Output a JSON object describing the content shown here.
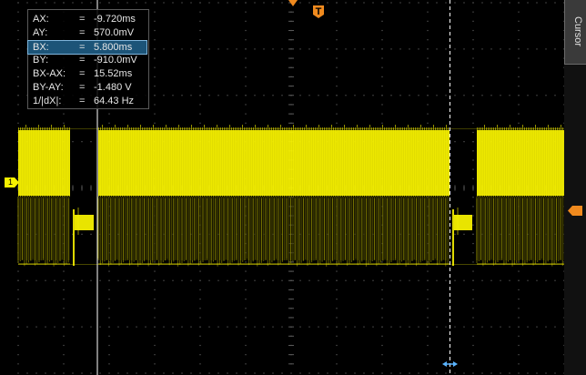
{
  "cursor_panel": {
    "rows": [
      {
        "label": "AX:",
        "eq": "=",
        "value": "-9.720ms",
        "highlighted": false
      },
      {
        "label": "AY:",
        "eq": "=",
        "value": "570.0mV",
        "highlighted": false
      },
      {
        "label": "BX:",
        "eq": "=",
        "value": "5.800ms",
        "highlighted": true
      },
      {
        "label": "BY:",
        "eq": "=",
        "value": "-910.0mV",
        "highlighted": false
      },
      {
        "label": "BX-AX:",
        "eq": "=",
        "value": "15.52ms",
        "highlighted": false
      },
      {
        "label": "BY-AY:",
        "eq": "=",
        "value": "-1.480 V",
        "highlighted": false
      },
      {
        "label": "1/|dX|:",
        "eq": "=",
        "value": "64.43 Hz",
        "highlighted": false
      }
    ]
  },
  "side_menu": {
    "title": "Cursor"
  },
  "markers": {
    "trigger_label": "T",
    "channel_label": "1"
  },
  "colors": {
    "background": "#000000",
    "grid": "#5a5a5a",
    "trace": "#f5f000",
    "trace_dim": "#8a8400",
    "marker_orange": "#f08a1e",
    "cursor_line": "#ffffff",
    "channel_marker": "#f5f000",
    "highlight": "#1c5478"
  },
  "icons": {
    "trigger_position": "trigger-arrow-icon",
    "channel_offset": "channel-1-marker-icon",
    "trigger_level": "trigger-level-arrow-icon",
    "cursor_b_handle": "double-arrow-icon"
  }
}
